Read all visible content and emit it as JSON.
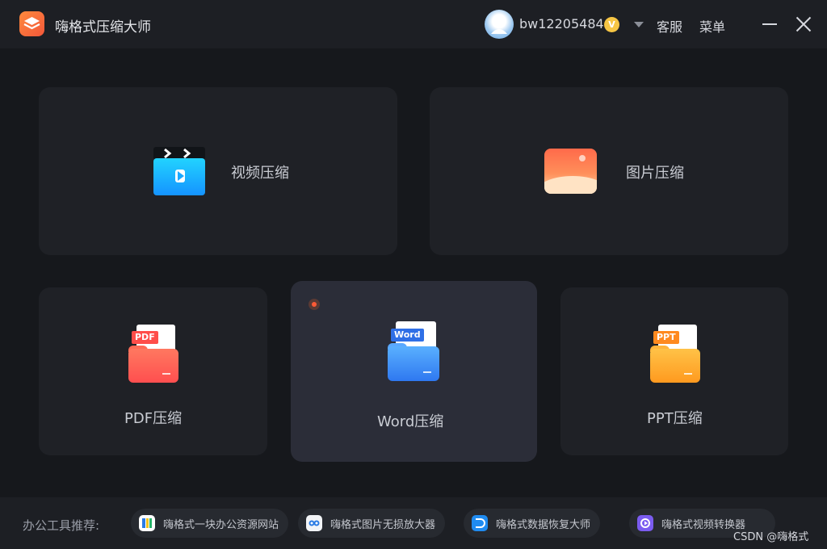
{
  "app": {
    "title": "嗨格式压缩大师"
  },
  "header": {
    "username": "bw12205484",
    "vip_badge": "V",
    "service_label": "客服",
    "menu_label": "菜单"
  },
  "cards": {
    "video": {
      "label": "视频压缩"
    },
    "image": {
      "label": "图片压缩"
    },
    "pdf": {
      "label": "PDF压缩",
      "tag": "PDF"
    },
    "word": {
      "label": "Word压缩",
      "tag": "Word"
    },
    "ppt": {
      "label": "PPT压缩",
      "tag": "PPT"
    }
  },
  "footer": {
    "label": "办公工具推荐:",
    "recommendations": [
      {
        "text": "嗨格式一块办公资源网站",
        "icon": "office-resource-icon",
        "color": "#2a7be4"
      },
      {
        "text": "嗨格式图片无损放大器",
        "icon": "image-enlarger-icon",
        "color": "#f2f4f7"
      },
      {
        "text": "嗨格式数据恢复大师",
        "icon": "data-recovery-icon",
        "color": "#1f8bf0"
      },
      {
        "text": "嗨格式视频转换器",
        "icon": "video-converter-icon",
        "color": "#7b5cf0"
      }
    ]
  },
  "watermark": "CSDN @嗨格式",
  "colors": {
    "background": "#16181c",
    "card": "#1f2126",
    "card_active": "#2b2d38",
    "accent_orange": "#ff5a36",
    "pdf": "#ff5b55",
    "word": "#3b82f6",
    "ppt": "#ffa42a"
  }
}
